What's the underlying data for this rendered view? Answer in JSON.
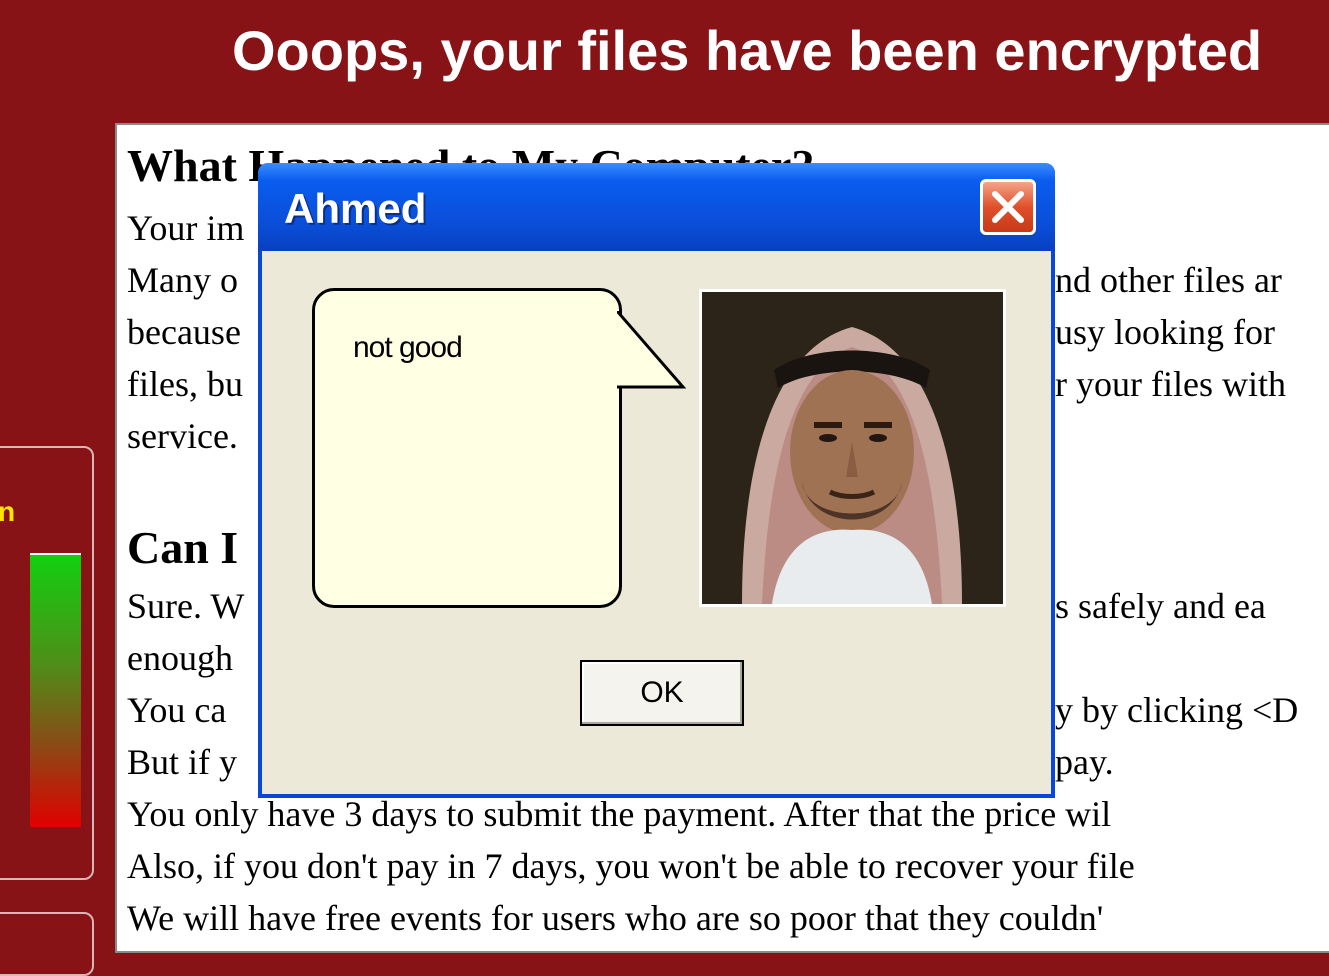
{
  "window": {
    "title": "Ooops, your files have been encrypted"
  },
  "side_panel": {
    "label_fragment": "n"
  },
  "panel": {
    "heading1": "What Happened to My Computer?",
    "lines1": [
      "Your im",
      "Many o",
      "because",
      "files, bu",
      "service."
    ],
    "lines1_right": [
      "nd other files ar",
      "usy looking for",
      "r your files with"
    ],
    "heading2": "Can I",
    "lines2": [
      "Sure. W",
      "enough",
      "You ca",
      "But if y"
    ],
    "lines2_right": [
      "s safely and ea",
      "",
      "y by clicking <D",
      "pay."
    ],
    "lines3": [
      "You only have 3 days to submit the payment. After that the price wil",
      "Also, if you don't pay in 7 days, you won't be able to recover your file",
      "We will have free events for users who are so poor that they couldn'"
    ]
  },
  "dialog": {
    "title": "Ahmed",
    "message": "not good",
    "ok_label": "OK",
    "close_icon": "close-icon",
    "accent": "#0a46d8"
  }
}
